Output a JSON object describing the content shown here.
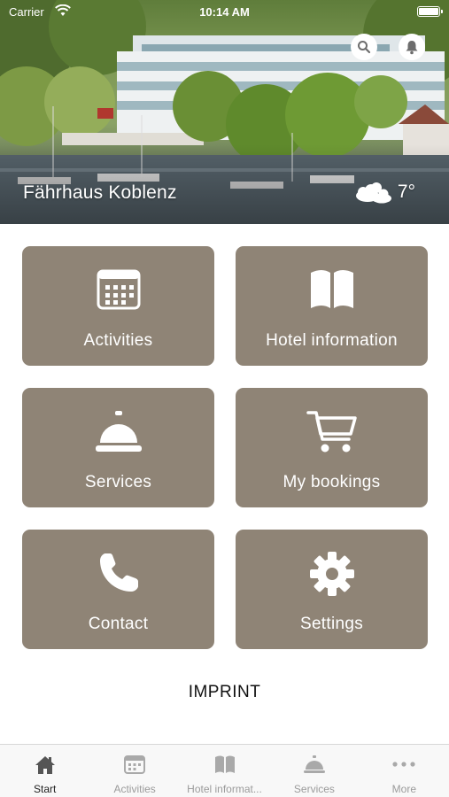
{
  "status_bar": {
    "carrier": "Carrier",
    "time": "10:14 AM"
  },
  "header": {
    "hotel_name": "Fährhaus Koblenz",
    "weather": {
      "icon": "cloud-sun-icon",
      "temperature": "7°"
    },
    "actions": [
      {
        "icon": "search-icon"
      },
      {
        "icon": "bell-icon"
      }
    ]
  },
  "tiles": [
    {
      "label": "Activities",
      "icon": "calendar-icon"
    },
    {
      "label": "Hotel information",
      "icon": "book-icon"
    },
    {
      "label": "Services",
      "icon": "service-bell-icon"
    },
    {
      "label": "My bookings",
      "icon": "cart-icon"
    },
    {
      "label": "Contact",
      "icon": "phone-icon"
    },
    {
      "label": "Settings",
      "icon": "gear-icon"
    }
  ],
  "imprint_label": "IMPRINT",
  "tab_bar": [
    {
      "label": "Start",
      "icon": "home-icon",
      "active": true
    },
    {
      "label": "Activities",
      "icon": "calendar-icon",
      "active": false
    },
    {
      "label": "Hotel informat...",
      "icon": "book-icon",
      "active": false
    },
    {
      "label": "Services",
      "icon": "service-bell-icon",
      "active": false
    },
    {
      "label": "More",
      "icon": "more-icon",
      "active": false
    }
  ],
  "colors": {
    "tile_background": "#8f8476",
    "tab_active": "#222222",
    "tab_inactive": "#9b9b9b"
  }
}
